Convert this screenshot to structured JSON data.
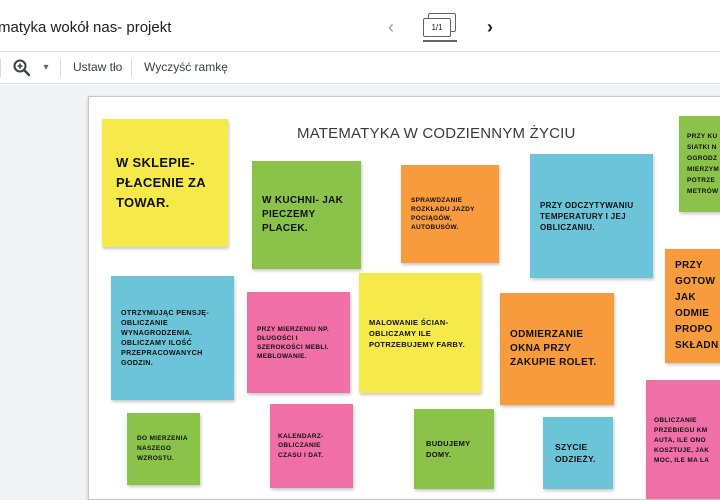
{
  "header": {
    "doc_title": "matyka wokół nas- projekt",
    "frame_counter": "1/1",
    "prev_icon": "chevron-left-icon",
    "next_icon": "chevron-right-icon"
  },
  "toolbar": {
    "zoom_icon": "zoom-in-icon",
    "set_background": "Ustaw tło",
    "clear_frame": "Wyczyść ramkę"
  },
  "slide": {
    "title": "MATEMATYKA W CODZIENNYM ŻYCIU",
    "notes": [
      {
        "name": "note-w-sklepie",
        "color": "yellow",
        "text": "W SKLEPIE- PŁACENIE ZA TOWAR."
      },
      {
        "name": "note-w-kuchni",
        "color": "green",
        "text": "W KUCHNI- JAK PIECZEMY PLACEK."
      },
      {
        "name": "note-sprawdzanie-rozkladu",
        "color": "orange",
        "text": "SPRAWDZANIE ROZKŁADU JAZDY POCIĄGÓW, AUTOBUSÓW."
      },
      {
        "name": "note-temperatura",
        "color": "cyan",
        "text": "PRZY ODCZYTYWANIU TEMPERATURY I JEJ OBLICZANIU."
      },
      {
        "name": "note-siatki",
        "color": "green",
        "text": "PRZY KU SIATKI N OGRODZ MIERZYM POTRZE METRÓW"
      },
      {
        "name": "note-pensja",
        "color": "cyan",
        "text": "OTRZYMUJĄC PENSJĘ- OBLICZANIE WYNAGRODZENIA. OBLICZAMY ILOŚĆ PRZEPRACOWANYCH GODZIN."
      },
      {
        "name": "note-mierzenie-mebli",
        "color": "pink",
        "text": "PRZY MIERZENIU NP. DŁUGOŚCI I SZEROKOŚCI MEBLI. MEBLOWANIE."
      },
      {
        "name": "note-malowanie",
        "color": "yellow",
        "text": "MALOWANIE ŚCIAN- OBLICZAMY ILE POTRZEBUJEMY FARBY."
      },
      {
        "name": "note-okna",
        "color": "orange",
        "text": "ODMIERZANIE OKNA PRZY ZAKUPIE ROLET."
      },
      {
        "name": "note-gotowanie",
        "color": "orange",
        "text": "PRZY GOTOW JAK ODMIE PROPO SKŁADN"
      },
      {
        "name": "note-wzrost",
        "color": "green",
        "text": "DO MIERZENIA NASZEGO WZROSTU."
      },
      {
        "name": "note-kalendarz",
        "color": "pink",
        "text": "KALENDARZ- OBLICZANIE CZASU I DAT."
      },
      {
        "name": "note-budujemy",
        "color": "green",
        "text": "BUDUJEMY DOMY."
      },
      {
        "name": "note-szycie",
        "color": "cyan",
        "text": "SZYCIE ODZIEŻY."
      },
      {
        "name": "note-auta",
        "color": "pink",
        "text": "OBLICZANIE PRZEBIEGU KM AUTA, ILE ONO KOSZTUJE, JAK MOC, ILE MA LA"
      }
    ]
  }
}
